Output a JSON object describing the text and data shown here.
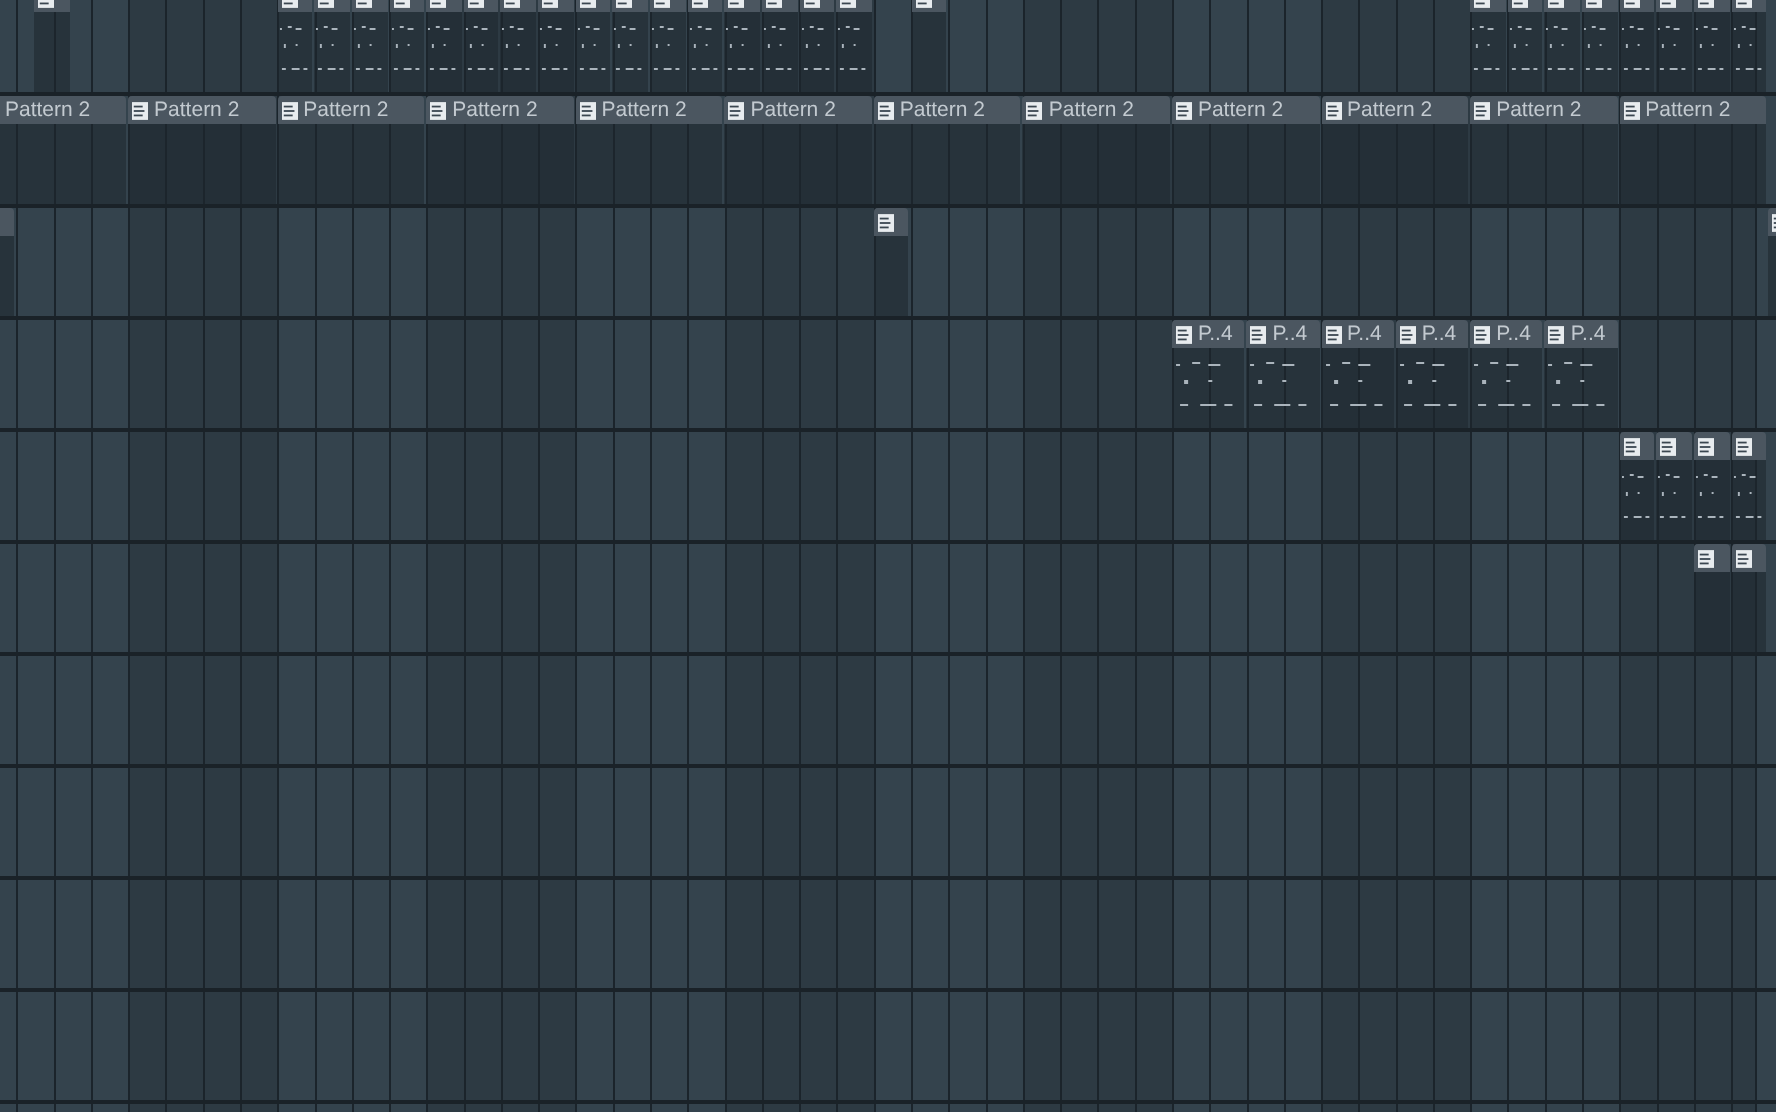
{
  "tracks": [
    {
      "clips": [
        {
          "kind": "plain"
        },
        {
          "kind": "notes"
        },
        {
          "kind": "notes"
        },
        {
          "kind": "notes"
        },
        {
          "kind": "notes"
        },
        {
          "kind": "notes"
        },
        {
          "kind": "notes"
        },
        {
          "kind": "notes"
        },
        {
          "kind": "notes"
        },
        {
          "kind": "notes"
        },
        {
          "kind": "notes"
        },
        {
          "kind": "notes"
        },
        {
          "kind": "notes"
        },
        {
          "kind": "notes"
        },
        {
          "kind": "notes"
        },
        {
          "kind": "notes"
        },
        {
          "kind": "notes"
        },
        {
          "kind": "plain"
        },
        {
          "kind": "notes"
        },
        {
          "kind": "notes"
        },
        {
          "kind": "notes"
        },
        {
          "kind": "notes"
        },
        {
          "kind": "notes"
        },
        {
          "kind": "notes"
        },
        {
          "kind": "notes"
        },
        {
          "kind": "notes"
        }
      ]
    },
    {
      "clips": [
        {
          "kind": "plain",
          "label": "Pattern 2"
        },
        {
          "kind": "plain",
          "label": "Pattern 2"
        },
        {
          "kind": "plain",
          "label": "Pattern 2"
        },
        {
          "kind": "plain",
          "label": "Pattern 2"
        },
        {
          "kind": "plain",
          "label": "Pattern 2"
        },
        {
          "kind": "plain",
          "label": "Pattern 2"
        },
        {
          "kind": "plain",
          "label": "Pattern 2"
        },
        {
          "kind": "plain",
          "label": "Pattern 2"
        },
        {
          "kind": "plain",
          "label": "Pattern 2"
        },
        {
          "kind": "plain",
          "label": "Pattern 2"
        },
        {
          "kind": "plain",
          "label": "Pattern 2"
        },
        {
          "kind": "plain",
          "label": "Pattern 2"
        }
      ]
    },
    {
      "clips": [
        {
          "kind": "plain"
        },
        {
          "kind": "plain"
        },
        {
          "kind": "plain"
        }
      ]
    },
    {
      "clips": [
        {
          "kind": "notes",
          "label": "P..4"
        },
        {
          "kind": "notes",
          "label": "P..4"
        },
        {
          "kind": "notes",
          "label": "P..4"
        },
        {
          "kind": "notes",
          "label": "P..4"
        },
        {
          "kind": "notes",
          "label": "P..4"
        },
        {
          "kind": "notes",
          "label": "P..4"
        }
      ]
    },
    {
      "clips": [
        {
          "kind": "notes"
        },
        {
          "kind": "notes"
        },
        {
          "kind": "notes"
        },
        {
          "kind": "notes"
        }
      ]
    },
    {
      "clips": [
        {
          "kind": "plain"
        },
        {
          "kind": "plain"
        }
      ]
    }
  ]
}
